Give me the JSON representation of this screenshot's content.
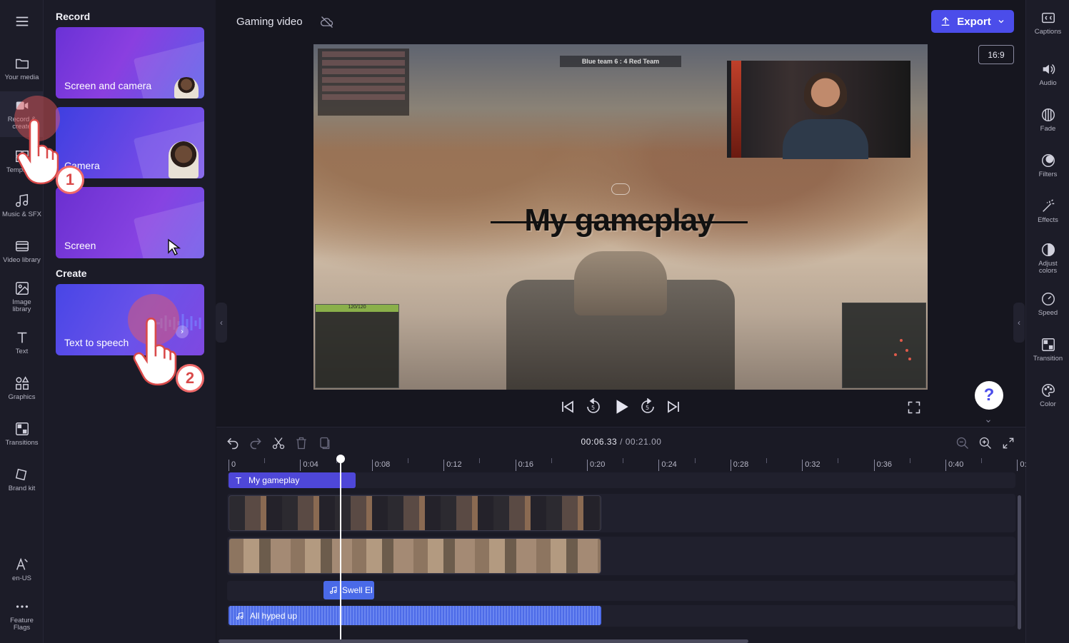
{
  "left_rail": {
    "items": [
      {
        "label": "Your media",
        "icon": "folder-icon"
      },
      {
        "label": "Record &\ncreate",
        "icon": "video-camera-icon"
      },
      {
        "label": "Templates",
        "icon": "templates-icon"
      },
      {
        "label": "Music & SFX",
        "icon": "music-note-icon"
      },
      {
        "label": "Video library",
        "icon": "film-icon"
      },
      {
        "label": "Image\nlibrary",
        "icon": "image-icon"
      },
      {
        "label": "Text",
        "icon": "text-t-icon"
      },
      {
        "label": "Graphics",
        "icon": "shapes-icon"
      },
      {
        "label": "Transitions",
        "icon": "transition-icon"
      },
      {
        "label": "Brand kit",
        "icon": "brand-kit-icon"
      }
    ],
    "bottom": [
      {
        "label": "en-US",
        "icon": "language-icon"
      },
      {
        "label": "Feature\nFlags",
        "icon": "more-dots-icon"
      }
    ]
  },
  "panel": {
    "record_title": "Record",
    "create_title": "Create",
    "cards": {
      "screen_camera": "Screen and camera",
      "camera": "Camera",
      "screen": "Screen",
      "tts": "Text to speech"
    }
  },
  "annotations": {
    "step1": "1",
    "step2": "2"
  },
  "topbar": {
    "project_title": "Gaming video",
    "export_label": "Export",
    "aspect_ratio": "16:9"
  },
  "preview": {
    "overlay_title": "My gameplay",
    "scoreline": "Blue team 6 : 4  Red Team",
    "ammo": "120/120"
  },
  "help": {
    "label": "?"
  },
  "right_rail": {
    "items": [
      {
        "label": "Captions",
        "icon": "captions-icon"
      },
      {
        "label": "Audio",
        "icon": "speaker-icon"
      },
      {
        "label": "Fade",
        "icon": "fade-icon"
      },
      {
        "label": "Filters",
        "icon": "filters-icon"
      },
      {
        "label": "Effects",
        "icon": "magic-wand-icon"
      },
      {
        "label": "Adjust\ncolors",
        "icon": "contrast-icon"
      },
      {
        "label": "Speed",
        "icon": "speedometer-icon"
      },
      {
        "label": "Transition",
        "icon": "transition-icon"
      },
      {
        "label": "Color",
        "icon": "palette-icon"
      }
    ]
  },
  "timeline": {
    "current_time": "00:06.33",
    "total_time": "/ 00:21.00",
    "ticks": [
      "0",
      "0:04",
      "0:08",
      "0:12",
      "0:16",
      "0:20",
      "0:24",
      "0:28",
      "0:32",
      "0:36",
      "0:40",
      "0:"
    ],
    "clips": {
      "text": "My gameplay",
      "sfx": "Swell El",
      "audio": "All hyped up"
    }
  },
  "colors": {
    "accent": "#4b4dea",
    "audio_clip": "#4d6be8",
    "text_clip": "#4e47d8",
    "annotation": "#f06a6a"
  }
}
